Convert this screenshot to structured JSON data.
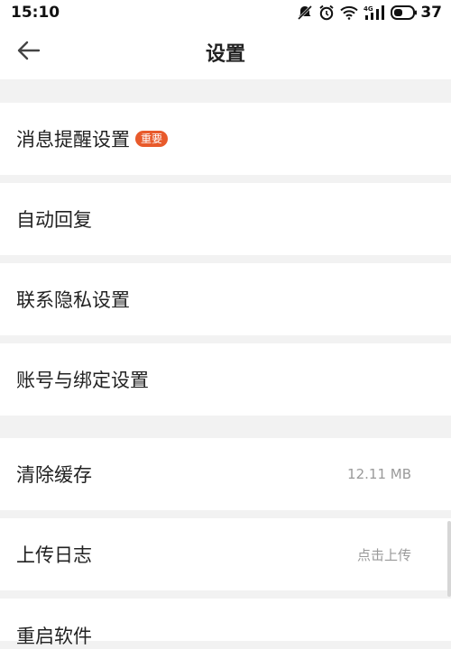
{
  "status_bar": {
    "time": "15:10",
    "battery": "37",
    "icons": [
      "mute-icon",
      "alarm-icon",
      "wifi-icon",
      "signal-4g-icon",
      "battery-icon"
    ]
  },
  "header": {
    "title": "设置",
    "back_icon": "arrow-left-icon"
  },
  "settings": {
    "notifications": {
      "label": "消息提醒设置",
      "badge": "重要"
    },
    "auto_reply": {
      "label": "自动回复"
    },
    "contact_privacy": {
      "label": "联系隐私设置"
    },
    "account_binding": {
      "label": "账号与绑定设置"
    },
    "clear_cache": {
      "label": "清除缓存",
      "value": "12.11 MB"
    },
    "upload_log": {
      "label": "上传日志",
      "value": "点击上传"
    },
    "restart_app": {
      "label": "重启软件"
    }
  },
  "colors": {
    "accent": "#e85a2b",
    "background": "#f2f2f2",
    "row_background": "#ffffff",
    "secondary_text": "#9a9a9a"
  }
}
